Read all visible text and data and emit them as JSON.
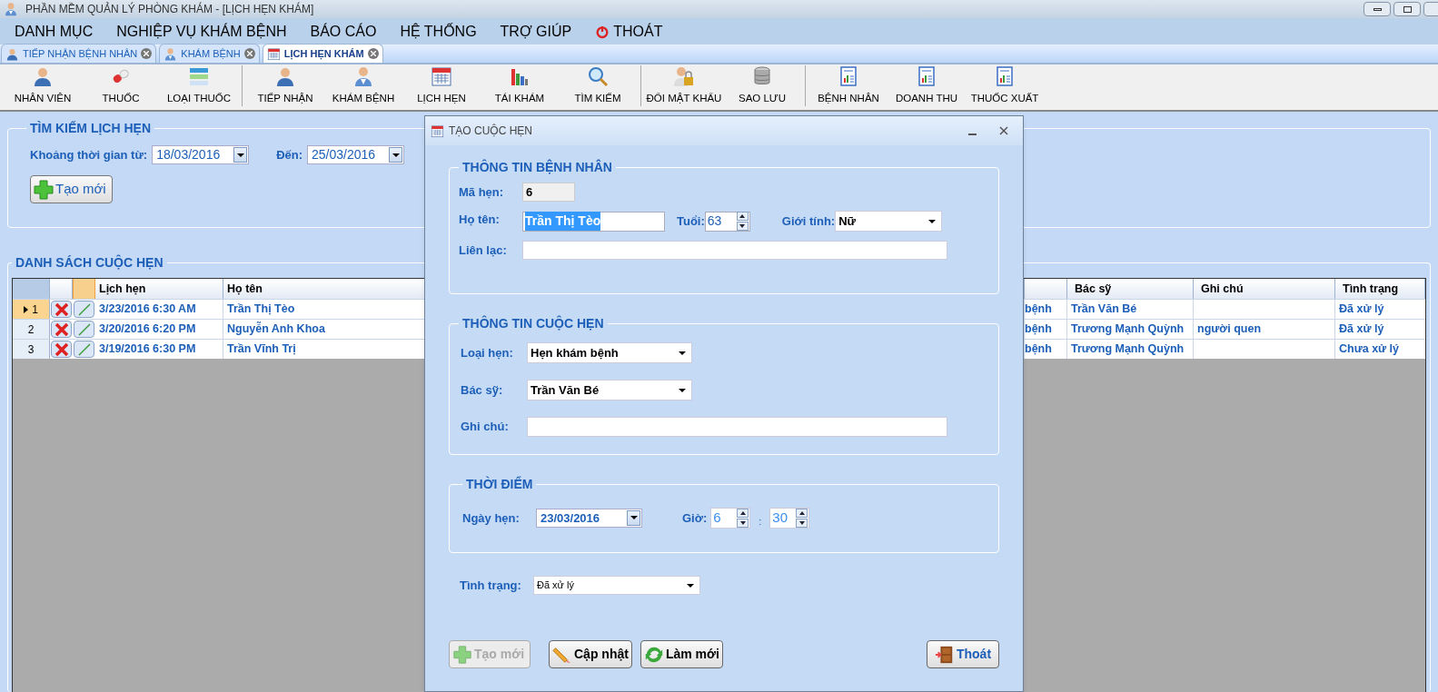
{
  "window": {
    "title": "PHẦN MỀM QUẢN LÝ PHÒNG KHÁM - [LỊCH HẸN KHÁM]"
  },
  "menu": [
    {
      "label": "DANH MỤC",
      "kind": "text"
    },
    {
      "label": "NGHIỆP VỤ KHÁM BỆNH",
      "kind": "text"
    },
    {
      "label": "BÁO CÁO",
      "kind": "text"
    },
    {
      "label": "HỆ THỐNG",
      "kind": "text"
    },
    {
      "label": "TRỢ GIÚP",
      "kind": "text"
    },
    {
      "label": "THOÁT",
      "kind": "power"
    }
  ],
  "tabs": [
    {
      "label": "TIẾP NHẬN BỆNH NHÂN",
      "kind": "person",
      "selected": false
    },
    {
      "label": "KHÁM BỆNH",
      "kind": "doctor",
      "selected": false
    },
    {
      "label": "LỊCH HẸN KHÁM",
      "kind": "calendar",
      "selected": true
    }
  ],
  "toolbar": [
    [
      {
        "label": "NHÂN VIÊN",
        "kind": "person"
      },
      {
        "label": "THUỐC",
        "kind": "pill"
      },
      {
        "label": "LOẠI THUỐC",
        "kind": "list"
      }
    ],
    [
      {
        "label": "TIẾP NHẬN",
        "kind": "person"
      },
      {
        "label": "KHÁM BỆNH",
        "kind": "doctor"
      },
      {
        "label": "LỊCH HẸN",
        "kind": "calendar"
      },
      {
        "label": "TÁI KHÁM",
        "kind": "chart"
      },
      {
        "label": "TÌM KIẾM",
        "kind": "search"
      }
    ],
    [
      {
        "label": "ĐỔI MẬT KHẨU",
        "kind": "lock"
      },
      {
        "label": "SAO LƯU",
        "kind": "database"
      }
    ],
    [
      {
        "label": "BỆNH NHÂN",
        "kind": "report"
      },
      {
        "label": "DOANH THU",
        "kind": "report"
      },
      {
        "label": "THUỐC XUẤT",
        "kind": "report"
      }
    ]
  ],
  "search": {
    "title": "TÌM KIẾM LỊCH HẸN",
    "from_label": "Khoảng thời gian từ:",
    "from_value": "18/03/2016",
    "to_label": "Đến:",
    "to_value": "25/03/2016",
    "new_button": "Tạo mới"
  },
  "list": {
    "title": "DANH SÁCH CUỘC HẸN",
    "columns": [
      "Lịch hẹn",
      "Họ tên",
      "Bác sỹ",
      "Ghi chú",
      "Tình trạng"
    ],
    "rows": [
      {
        "number": "1",
        "selected": true,
        "date": "3/23/2016 6:30 AM",
        "name": "Trần Thị Tèo",
        "column_6": "bệnh",
        "doctor": "Trần Văn Bé",
        "note": "",
        "status": "Đã xử lý"
      },
      {
        "number": "2",
        "selected": false,
        "date": "3/20/2016 6:20 PM",
        "name": "Nguyễn Anh Khoa",
        "column_6": "bệnh",
        "doctor": "Trương Mạnh Quỳnh",
        "note": "người quen",
        "status": "Đã xử lý"
      },
      {
        "number": "3",
        "selected": false,
        "date": "3/19/2016 6:30 PM",
        "name": "Trần Vĩnh Trị",
        "column_6": "bệnh",
        "doctor": "Trương Mạnh Quỳnh",
        "note": "",
        "status": "Chưa xử lý"
      }
    ]
  },
  "dialog": {
    "title": "TẠO CUỘC HẸN",
    "patient": {
      "title": "THÔNG TIN BỆNH NHÂN",
      "id_label": "Mã hẹn:",
      "id_value": "6",
      "name_label": "Họ tên:",
      "name_value": "Trần Thị Tèo",
      "name_selected": true,
      "age_label": "Tuổi:",
      "age_value": "63",
      "gender_label": "Giới tính:",
      "gender_value": "Nữ",
      "contact_label": "Liên lạc:"
    },
    "appointment": {
      "title": "THÔNG TIN CUỘC HẸN",
      "type_label": "Loại hẹn:",
      "type_value": "Hẹn khám bệnh",
      "doctor_label": "Bác sỹ:",
      "doctor_value": "Trần Văn Bé",
      "note_label": "Ghi chú:"
    },
    "time": {
      "title": "THỜI ĐIỂM",
      "date_label": "Ngày hẹn:",
      "date_value": "23/03/2016",
      "hour_label": "Giờ:",
      "hour_value": "6",
      "separator": ":",
      "minute_value": "30"
    },
    "status_label": "Tình trạng:",
    "status_value": "Đã xử lý",
    "buttons": [
      {
        "label": "Tạo mới",
        "kind": "plus",
        "disabled": true
      },
      {
        "label": "Cập nhật",
        "kind": "pencil",
        "disabled": false
      },
      {
        "label": "Làm mới",
        "kind": "refresh",
        "disabled": false
      },
      {
        "label": "Thoát",
        "kind": "door",
        "disabled": false
      }
    ]
  }
}
